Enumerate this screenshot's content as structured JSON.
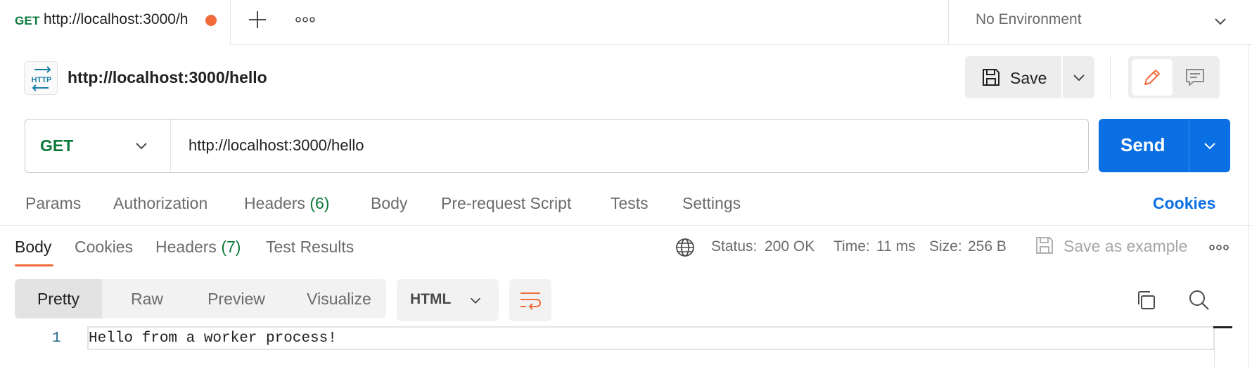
{
  "tab_bar": {
    "active_tab": {
      "method": "GET",
      "url": "http://localhost:3000/h"
    },
    "environment": "No Environment"
  },
  "request": {
    "title": "http://localhost:3000/hello",
    "save_label": "Save",
    "method": "GET",
    "url": "http://localhost:3000/hello",
    "send_label": "Send"
  },
  "request_tabs": {
    "params": "Params",
    "authorization": "Authorization",
    "headers": "Headers",
    "headers_count": "(6)",
    "body": "Body",
    "pre_request": "Pre-request Script",
    "tests": "Tests",
    "settings": "Settings",
    "cookies": "Cookies"
  },
  "response_tabs": {
    "body": "Body",
    "cookies": "Cookies",
    "headers": "Headers",
    "headers_count": "(7)",
    "test_results": "Test Results"
  },
  "response_status": {
    "status_label": "Status:",
    "status_value": "200 OK",
    "time_label": "Time:",
    "time_value": "11 ms",
    "size_label": "Size:",
    "size_value": "256 B",
    "save_example": "Save as example"
  },
  "view_modes": {
    "pretty": "Pretty",
    "raw": "Raw",
    "preview": "Preview",
    "visualize": "Visualize",
    "language": "HTML"
  },
  "code": {
    "line_number": "1",
    "text": "Hello from a worker process!"
  },
  "colors": {
    "accent_orange": "#f26b3a",
    "method_green": "#0b7a3b",
    "send_blue": "#0b6fe4"
  },
  "icons": [
    "http-icon",
    "save-icon",
    "pencil-icon",
    "comment-icon",
    "globe-icon",
    "wrap-lines-icon",
    "copy-icon",
    "search-icon"
  ]
}
